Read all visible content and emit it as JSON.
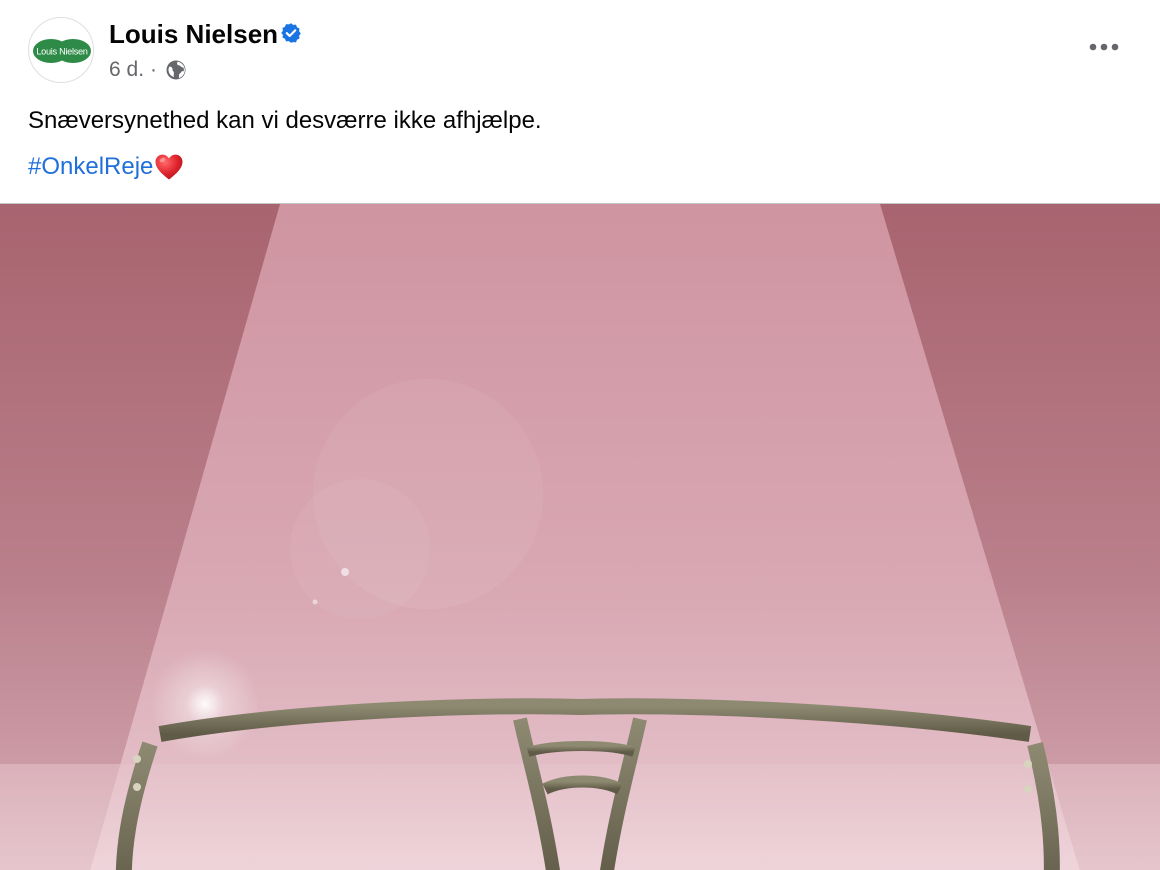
{
  "post": {
    "author": {
      "name": "Louis Nielsen",
      "verified": true,
      "avatar_logo_text": "Louis Nielsen",
      "avatar_color": "#2e8b47"
    },
    "meta": {
      "time": "6 d.",
      "separator": "·",
      "audience_icon": "globe-icon"
    },
    "more_icon": "more-options-icon",
    "caption": "Snæversynethed kan vi desværre ikke afhjælpe.",
    "hashtag": "#OnkelReje",
    "hashtag_emoji": "heart-emoji",
    "image": {
      "subject": "glasses",
      "background_color": "#c4909b",
      "frame_color": "#6e6a55"
    }
  },
  "colors": {
    "text": "#050505",
    "secondary_text": "#65676b",
    "link": "#216fdb",
    "verified_badge": "#1b74e4"
  }
}
